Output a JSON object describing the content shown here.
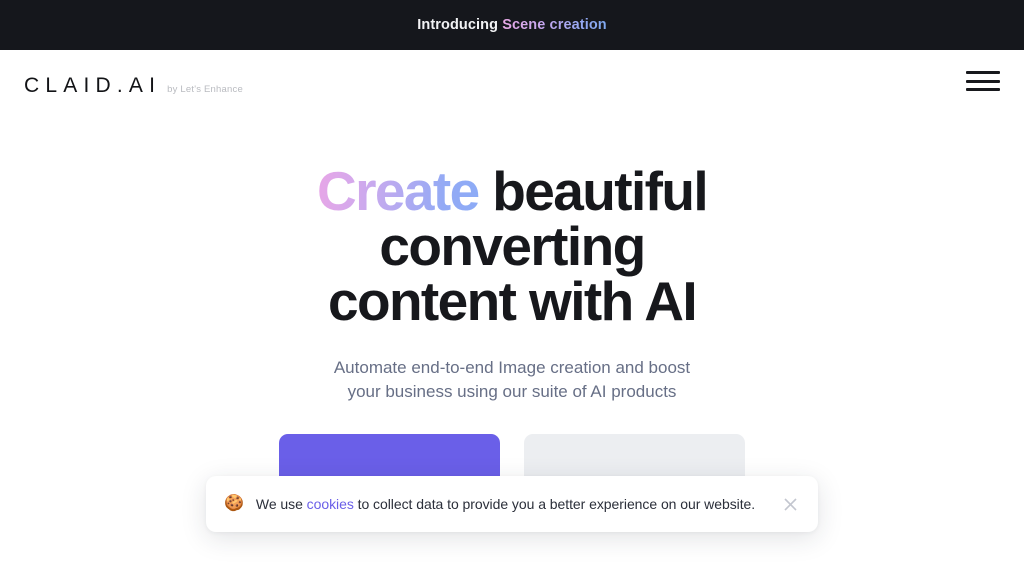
{
  "announcement": {
    "prefix": "Introducing ",
    "highlight": "Scene creation",
    "background": "#15171C",
    "highlight_gradient_from": "#E9A9E6",
    "highlight_gradient_to": "#7FA9F0"
  },
  "header": {
    "brand_name": "CLAID.AI",
    "brand_tagline": "by Let's Enhance",
    "menu_icon": "hamburger-menu-icon"
  },
  "hero": {
    "title_gradient_word": "Create",
    "title_line1_rest": " beautiful",
    "title_line2": "converting",
    "title_line3": "content with AI",
    "subtitle": "Automate end-to-end Image creation and boost your business using our suite of AI products",
    "title_gradient_from": "#E8A6E7",
    "title_gradient_to": "#8CABF6",
    "subtitle_color": "#676F86",
    "primary_cta": "",
    "secondary_cta": "",
    "primary_cta_color": "#6A5FE8",
    "secondary_cta_color": "#ECEEF1"
  },
  "cookie_banner": {
    "emoji": "🍪",
    "emoji_name": "cookie-icon",
    "text_before_link": "We use ",
    "link_label": "cookies",
    "text_after_link": " to collect data to provide you a better experience on our website.",
    "close_icon": "close-x-icon",
    "link_color": "#6A5FE8",
    "text_color": "#2B2F3A"
  }
}
